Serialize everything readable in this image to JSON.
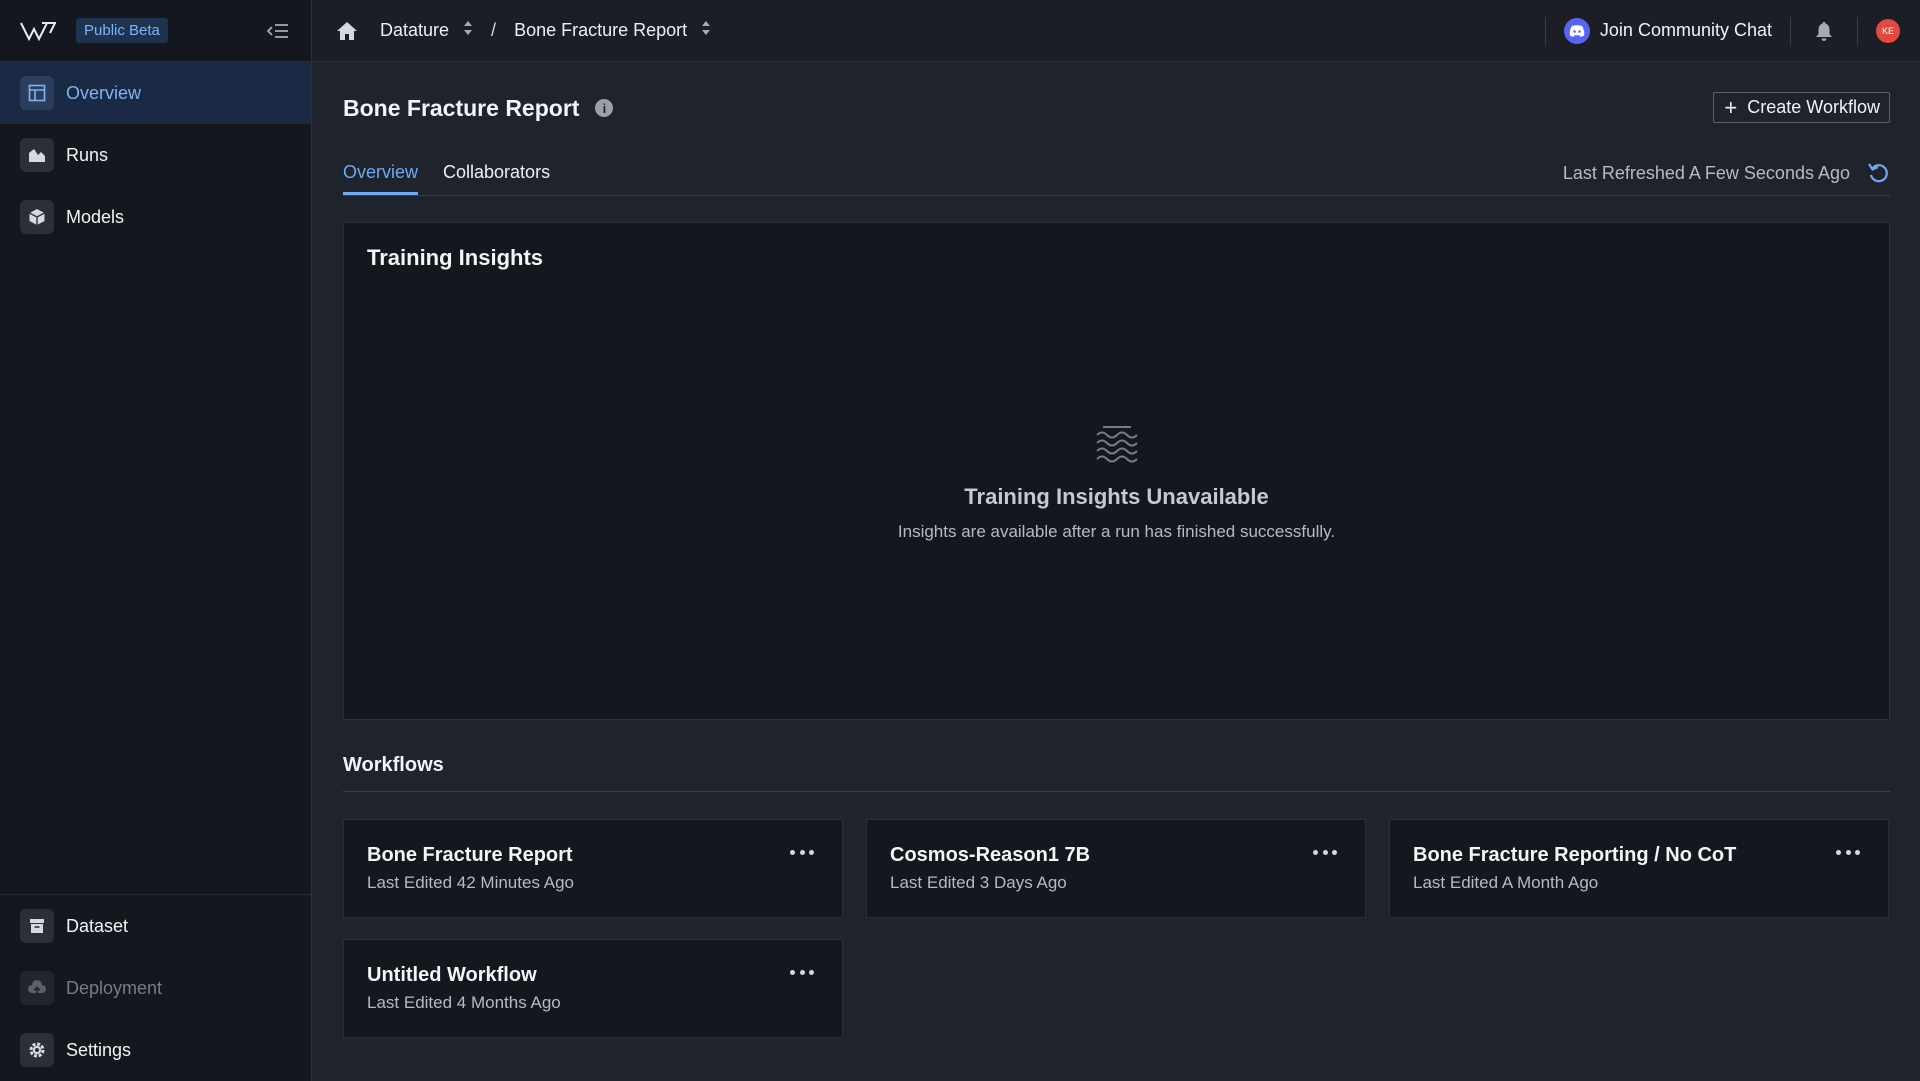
{
  "sidebar": {
    "beta_badge": "Public Beta",
    "nav": [
      {
        "label": "Overview",
        "icon": "layout-icon",
        "active": true
      },
      {
        "label": "Runs",
        "icon": "chart-area-icon"
      },
      {
        "label": "Models",
        "icon": "cube-icon"
      }
    ],
    "bottom_nav": [
      {
        "label": "Dataset",
        "icon": "archive-icon"
      },
      {
        "label": "Deployment",
        "icon": "cloud-upload-icon",
        "disabled": true
      },
      {
        "label": "Settings",
        "icon": "gear-icon"
      }
    ]
  },
  "topbar": {
    "breadcrumb": [
      "Datature",
      "Bone Fracture Report"
    ],
    "separator": "/",
    "community_label": "Join Community Chat",
    "avatar_initials": "KE"
  },
  "page": {
    "title": "Bone Fracture Report",
    "create_label": "Create Workflow",
    "tabs": [
      {
        "label": "Overview",
        "active": true
      },
      {
        "label": "Collaborators"
      }
    ],
    "last_refreshed": "Last Refreshed A Few Seconds Ago"
  },
  "insights": {
    "title": "Training Insights",
    "empty_title": "Training Insights Unavailable",
    "empty_subtitle": "Insights are available after a run has finished successfully."
  },
  "workflows": {
    "header": "Workflows",
    "items": [
      {
        "name": "Bone Fracture Report",
        "edited": "Last Edited 42 Minutes Ago"
      },
      {
        "name": "Cosmos-Reason1 7B",
        "edited": "Last Edited 3 Days Ago"
      },
      {
        "name": "Bone Fracture Reporting / No CoT",
        "edited": "Last Edited A Month Ago"
      },
      {
        "name": "Untitled Workflow",
        "edited": "Last Edited 4 Months Ago"
      }
    ]
  },
  "colors": {
    "accent": "#6fa8f2",
    "sidebar_bg": "#14171d",
    "page_bg": "#1f232c",
    "discord": "#5865f2",
    "avatar": "#e5483f"
  }
}
